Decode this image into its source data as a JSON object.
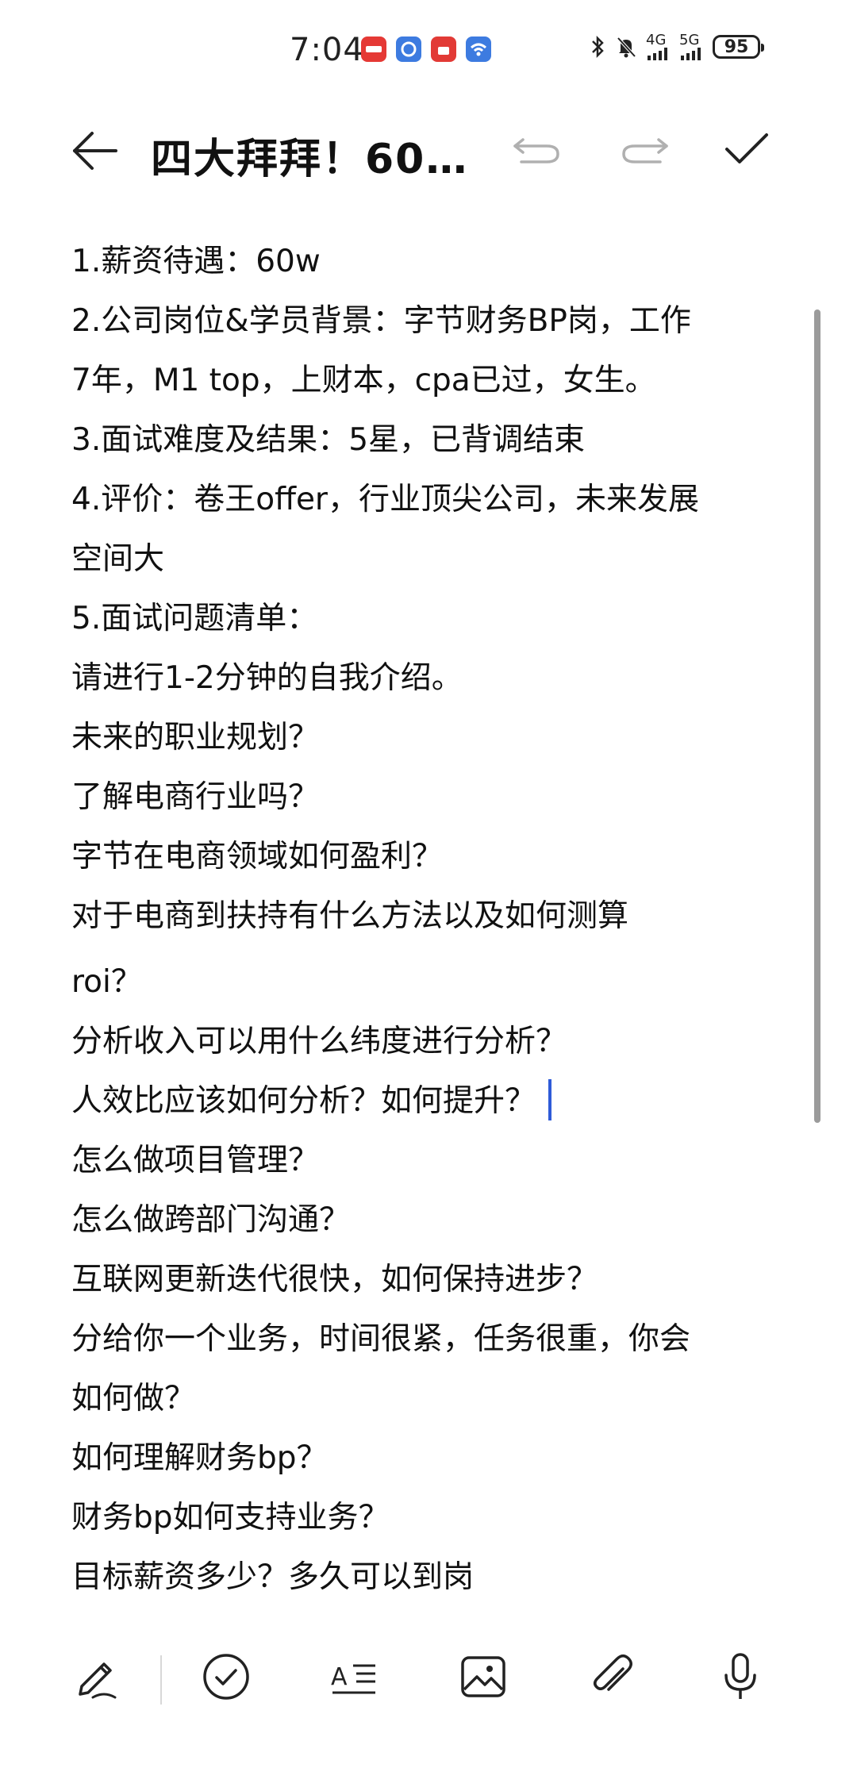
{
  "status_bar": {
    "time": "7:04",
    "network_4g": "4G",
    "network_5g": "5G",
    "battery": "95",
    "notification_icons": [
      "app-notification-icon",
      "browser-notification-icon",
      "store-notification-icon",
      "wifi-share-notification-icon"
    ]
  },
  "toolbar": {
    "title": "四大拜拜！60…"
  },
  "editor": {
    "lines": [
      "1.薪资待遇：60w",
      "2.公司岗位&学员背景：字节财务BP岗，工作",
      "7年，M1 top，上财本，cpa已过，女生。",
      "3.面试难度及结果：5星，已背调结束",
      "4.评价：卷王offer，行业顶尖公司，未来发展",
      "空间大",
      "5.面试问题清单：",
      "请进行1-2分钟的自我介绍。",
      "未来的职业规划？",
      "了解电商行业吗？",
      "字节在电商领域如何盈利？",
      "对于电商到扶持有什么方法以及如何测算",
      "roi？",
      "分析收入可以用什么纬度进行分析？",
      "人效比应该如何分析？如何提升？",
      "怎么做项目管理？",
      "怎么做跨部门沟通？",
      "互联网更新迭代很快，如何保持进步？",
      "分给你一个业务，时间很紧，任务很重，你会",
      "如何做？",
      "如何理解财务bp？",
      "财务bp如何支持业务？",
      "目标薪资多少？多久可以到岗"
    ]
  },
  "colors": {
    "caret": "#2f5bd8",
    "text": "#111111",
    "icon": "#222222",
    "disabled_icon": "#b0b0b0"
  }
}
